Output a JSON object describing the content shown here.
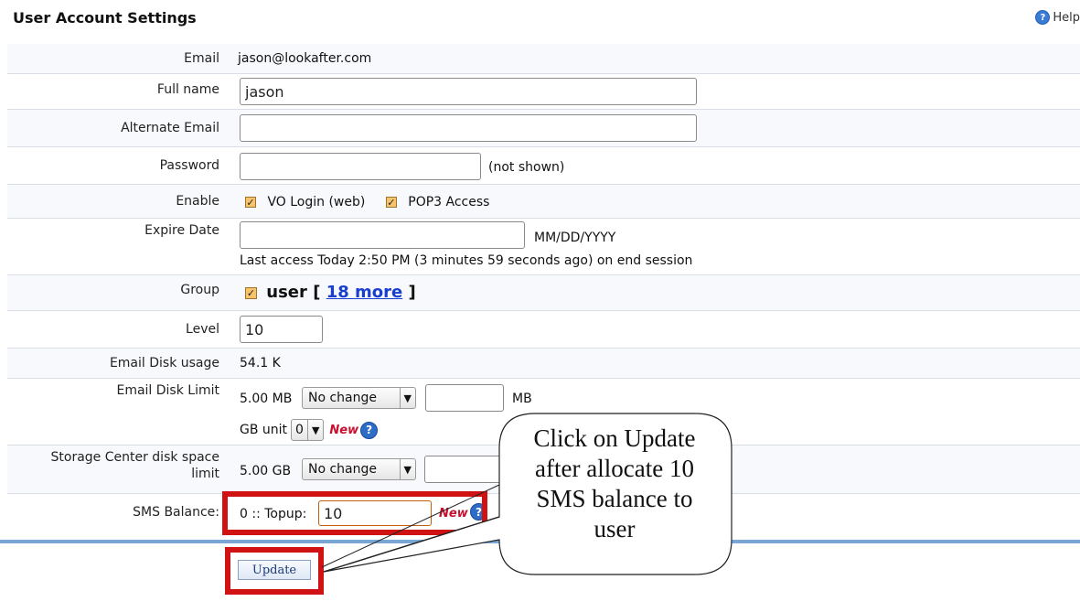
{
  "header": {
    "title": "User Account Settings",
    "help_label": "Help"
  },
  "form": {
    "email_label": "Email",
    "email_value": "jason@lookafter.com",
    "fullname_label": "Full name",
    "fullname_value": "jason",
    "alt_email_label": "Alternate Email",
    "alt_email_value": "",
    "password_label": "Password",
    "password_value": "",
    "password_note": "(not shown)",
    "enable_label": "Enable",
    "enable_options": [
      {
        "label": "VO Login (web)",
        "checked": true
      },
      {
        "label": "POP3 Access",
        "checked": true
      }
    ],
    "expire_label": "Expire Date",
    "expire_value": "",
    "expire_format": "MM/DD/YYYY",
    "last_access": "Last access Today 2:50 PM (3 minutes 59 seconds ago) on end session",
    "group_label": "Group",
    "group_value": "user",
    "group_open_bracket": "[",
    "group_more_link": "18 more",
    "group_close_bracket": "]",
    "level_label": "Level",
    "level_value": "10",
    "disk_usage_label": "Email Disk usage",
    "disk_usage_value": "54.1 K",
    "disk_limit_label": "Email Disk Limit",
    "disk_limit_current": "5.00 MB",
    "disk_limit_select": "No change",
    "disk_limit_input": "",
    "disk_limit_unit": "MB",
    "gb_unit_label": "GB unit",
    "gb_unit_select": "0",
    "new_label": "New",
    "storage_label_line1": "Storage Center disk space",
    "storage_label_line2": "limit",
    "storage_current": "5.00 GB",
    "storage_select": "No change",
    "storage_input": "",
    "sms_label": "SMS Balance:",
    "sms_prefix": "0 :: Topup:",
    "sms_value": "10"
  },
  "actions": {
    "update_label": "Update"
  },
  "callout": {
    "line1": "Click on Update",
    "line2": "after allocate 10",
    "line3": "SMS balance to",
    "line4": "user"
  },
  "colors": {
    "highlight": "#d01212",
    "accent_bar": "#7aa6d6",
    "link": "#1a3fd0",
    "new_tag": "#c8102e"
  },
  "icons": {
    "help": "help-circle-icon",
    "info": "question-circle-icon",
    "checkbox": "checked-checkbox-icon"
  }
}
